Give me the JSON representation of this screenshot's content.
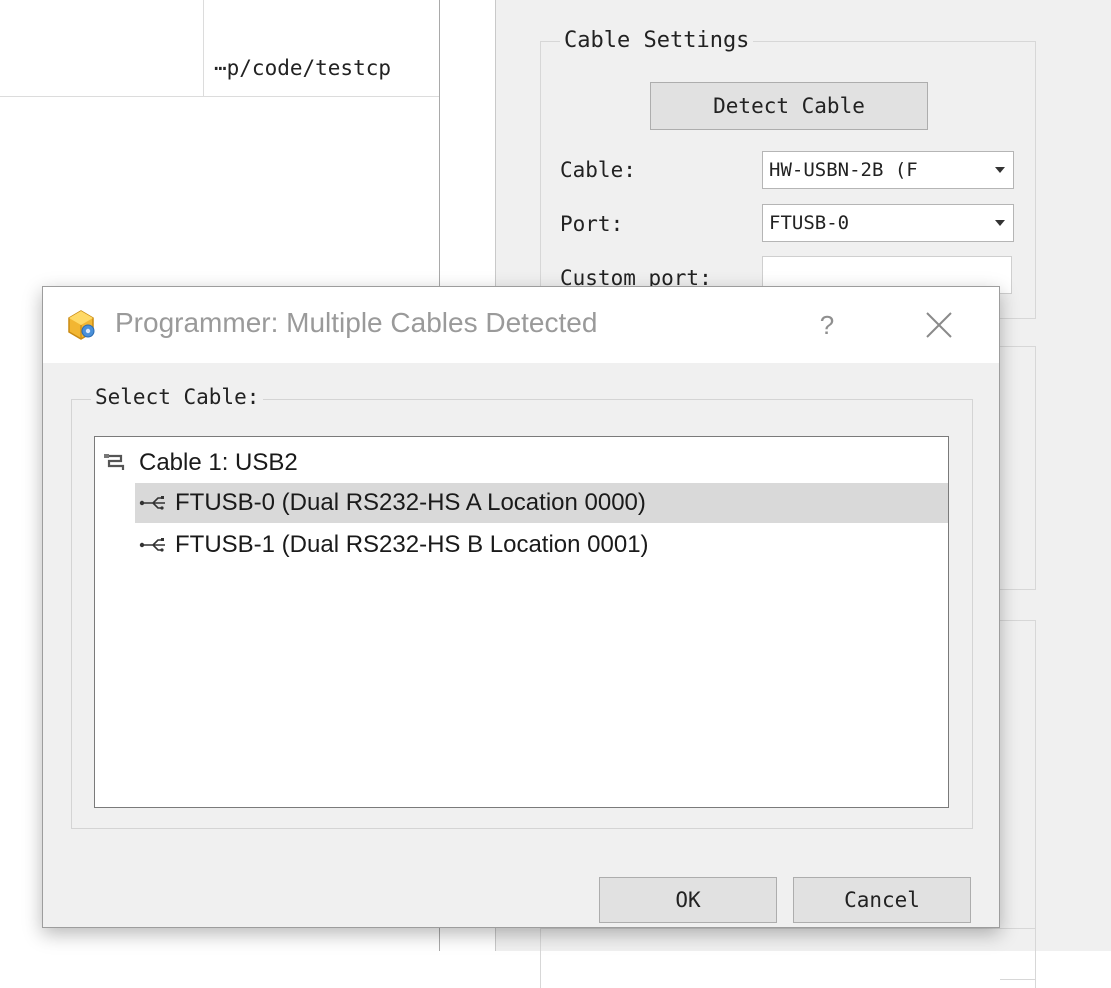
{
  "background": {
    "path_cell": "⋯p/code/testcp",
    "cable_settings": {
      "group_title": "Cable Settings",
      "detect_button": "Detect Cable",
      "cable_label": "Cable:",
      "cable_value": "HW-USBN-2B (F",
      "port_label": "Port:",
      "port_value": "FTUSB-0",
      "custom_port_label": "Custom port:",
      "custom_port_value": ""
    }
  },
  "dialog": {
    "title": "Programmer: Multiple Cables Detected",
    "help_label": "?",
    "select_label": "Select Cable:",
    "tree": {
      "root_label": "Cable 1: USB2",
      "items": [
        {
          "label": "FTUSB-0 (Dual RS232-HS A Location 0000)",
          "selected": true
        },
        {
          "label": "FTUSB-1 (Dual RS232-HS B Location 0001)",
          "selected": false
        }
      ]
    },
    "buttons": {
      "ok": "OK",
      "cancel": "Cancel"
    }
  },
  "icons": {
    "app": "programmer-app-icon",
    "help": "help-icon",
    "close": "close-icon",
    "cable": "cable-icon",
    "usb": "usb-icon",
    "dropdown": "chevron-down-icon"
  },
  "colors": {
    "dialog_bg": "#f0f0f0",
    "selection": "#d9d9d9",
    "title_text": "#9a9a9a"
  }
}
